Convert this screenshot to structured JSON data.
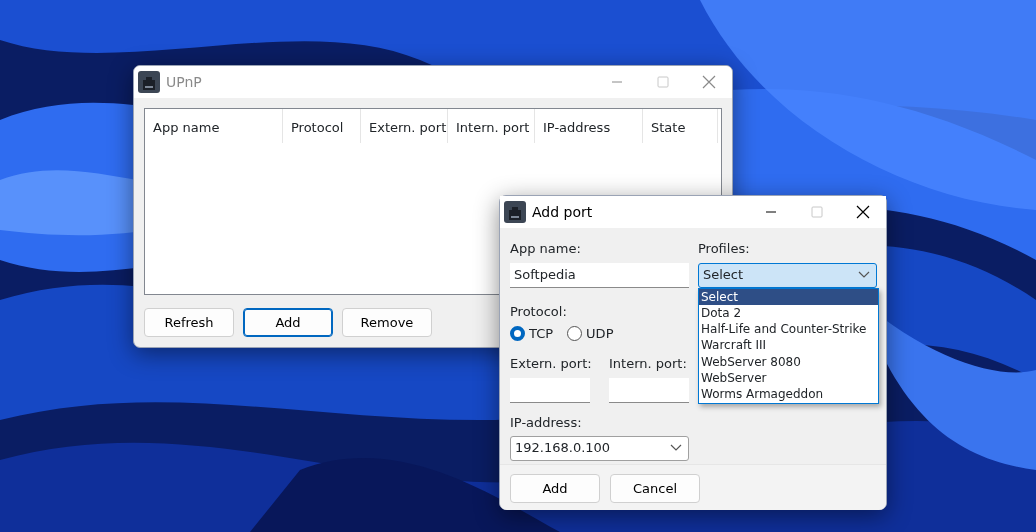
{
  "main_window": {
    "title": "UPnP",
    "active": false,
    "columns": [
      "App name",
      "Protocol",
      "Extern. port",
      "Intern. port",
      "IP-address",
      "State"
    ],
    "buttons": [
      {
        "label": "Refresh",
        "default": false
      },
      {
        "label": "Add",
        "default": true
      },
      {
        "label": "Remove",
        "default": false
      }
    ]
  },
  "add_port_dialog": {
    "title": "Add port",
    "active": true,
    "app_name": {
      "label": "App name:",
      "value": "Softpedia"
    },
    "profiles": {
      "label": "Profiles:",
      "value": "Select",
      "expanded": true,
      "options": [
        {
          "label": "Select",
          "selected": true
        },
        {
          "label": "Dota 2",
          "selected": false
        },
        {
          "label": "Half-Life and Counter-Strike",
          "selected": false
        },
        {
          "label": "Warcraft III",
          "selected": false
        },
        {
          "label": "WebServer 8080",
          "selected": false
        },
        {
          "label": "WebServer",
          "selected": false
        },
        {
          "label": "Worms Armageddon",
          "selected": false
        }
      ]
    },
    "protocol": {
      "label": "Protocol:",
      "options": [
        {
          "label": "TCP",
          "selected": true
        },
        {
          "label": "UDP",
          "selected": false
        }
      ]
    },
    "extern_port": {
      "label": "Extern. port:"
    },
    "intern_port": {
      "label": "Intern. port:"
    },
    "ip_address": {
      "label": "IP-address:",
      "value": "192.168.0.100"
    },
    "buttons": [
      {
        "label": "Add",
        "default": false
      },
      {
        "label": "Cancel",
        "default": false
      }
    ]
  }
}
